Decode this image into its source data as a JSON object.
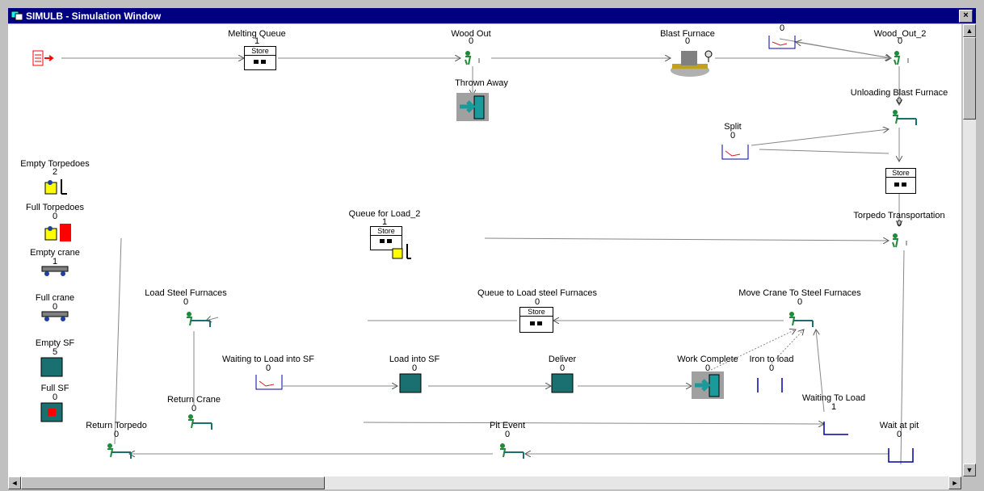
{
  "window": {
    "title": "SIMULB - Simulation Window",
    "close_label": "×"
  },
  "scrollbar": {
    "up": "▲",
    "down": "▼",
    "left": "◄",
    "right": "►"
  },
  "nodes": {
    "melting_queue": {
      "name": "Melting Queue",
      "count": "1",
      "store": "Store"
    },
    "wood_out": {
      "name": "Wood Out",
      "count": "0"
    },
    "blast_furnace": {
      "name": "Blast Furnace",
      "count": "0"
    },
    "top_queue": {
      "count": "0"
    },
    "wood_out_2": {
      "name": "Wood_Out_2",
      "count": "0"
    },
    "thrown_away": {
      "name": "Thrown Away"
    },
    "unloading_blast_furnace": {
      "name": "Unloading Blast Furnace",
      "count": "0"
    },
    "split": {
      "name": "Split",
      "count": "0"
    },
    "blast_store": {
      "store": "Store"
    },
    "empty_torpedoes": {
      "name": "Empty Torpedoes",
      "count": "2"
    },
    "full_torpedoes": {
      "name": "Full Torpedoes",
      "count": "0"
    },
    "empty_crane": {
      "name": "Empty crane",
      "count": "1"
    },
    "full_crane": {
      "name": "Full crane",
      "count": "0"
    },
    "empty_sf": {
      "name": "Empty SF",
      "count": "5"
    },
    "full_sf": {
      "name": "Full SF",
      "count": "0"
    },
    "queue_for_load_2": {
      "name": "Queue for Load_2",
      "count": "1",
      "store": "Store"
    },
    "torpedo_transportation": {
      "name": "Torpedo Transportation",
      "count": "0"
    },
    "load_steel_furnaces": {
      "name": "Load Steel Furnaces",
      "count": "0"
    },
    "queue_to_load_steel_furnaces": {
      "name": "Queue to Load steel Furnaces",
      "count": "0",
      "store": "Store"
    },
    "move_crane_to_steel_furnaces": {
      "name": "Move Crane To Steel Furnaces",
      "count": "0"
    },
    "waiting_to_load_into_sf": {
      "name": "Waiting to Load into SF",
      "count": "0"
    },
    "load_into_sf": {
      "name": "Load into SF",
      "count": "0"
    },
    "deliver": {
      "name": "Deliver",
      "count": "0"
    },
    "work_complete": {
      "name": "Work Complete",
      "count": "0"
    },
    "iron_to_load": {
      "name": "Iron to load",
      "count": "0"
    },
    "return_crane": {
      "name": "Return Crane",
      "count": "0"
    },
    "waiting_to_load": {
      "name": "Waiting To Load",
      "count": "1"
    },
    "return_torpedo": {
      "name": "Return Torpedo",
      "count": "0"
    },
    "pit_event": {
      "name": "Pit Event",
      "count": "0"
    },
    "wait_at_pit": {
      "name": "Wait at pit",
      "count": "0"
    }
  },
  "colors": {
    "titlebar": "#000080",
    "teal": "#1a7070",
    "yellow": "#ffff00",
    "red": "#ff0000",
    "green": "#1e8a3a"
  }
}
